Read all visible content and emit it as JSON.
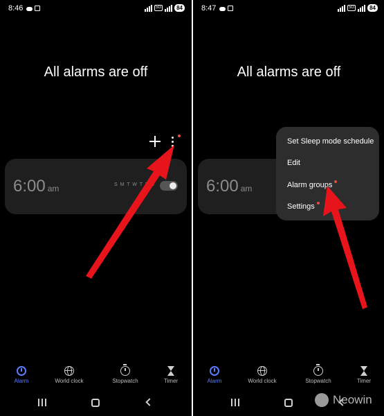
{
  "screens": [
    {
      "status_time": "8:46",
      "headline": "All alarms are off",
      "alarm": {
        "time": "6:00",
        "ampm": "am",
        "days": "S M T W T F S",
        "enabled": false
      }
    },
    {
      "status_time": "8:47",
      "headline": "All alarms are off",
      "alarm": {
        "time": "6:00",
        "ampm": "am"
      },
      "menu": [
        "Set Sleep mode schedule",
        "Edit",
        "Alarm groups",
        "Settings"
      ]
    }
  ],
  "battery": "84",
  "network_badge": "5G",
  "nav": [
    "Alarm",
    "World clock",
    "Stopwatch",
    "Timer"
  ],
  "active_nav": "Alarm",
  "watermark": "Neowin",
  "colors": {
    "accent": "#5c7cff",
    "arrow": "#e8141c",
    "badge_dot": "#e74c3c",
    "card": "#1f1f1f",
    "menu": "#2d2d2d"
  },
  "icons": [
    "add-icon",
    "more-options-icon",
    "alarm-icon",
    "globe-icon",
    "stopwatch-icon",
    "hourglass-icon",
    "recents-icon",
    "home-icon",
    "back-icon"
  ]
}
